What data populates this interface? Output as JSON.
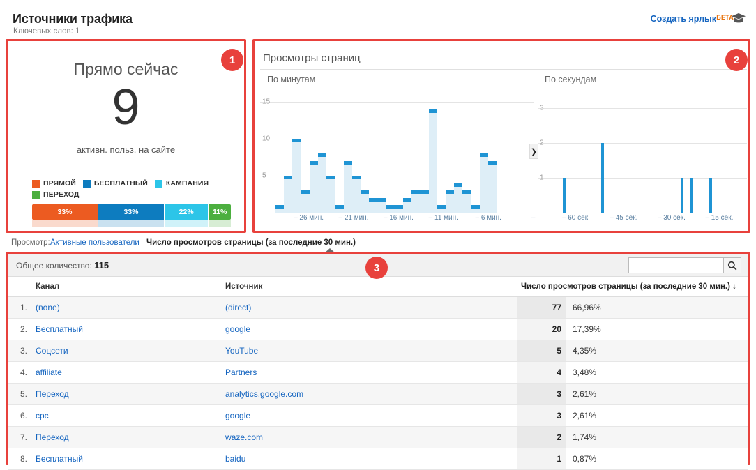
{
  "header": {
    "title": "Источники трафика",
    "subtitle": "Ключевых слов: 1",
    "create_shortcut": "Создать ярлык",
    "beta": "БЕТА",
    "cap_icon": "graduation-cap-icon"
  },
  "badges": {
    "one": "1",
    "two": "2",
    "three": "3"
  },
  "right_now": {
    "title": "Прямо сейчас",
    "count": "9",
    "caption": "активн. польз. на сайте",
    "legend": [
      {
        "label": "ПРЯМОЙ",
        "color": "#ec5b21"
      },
      {
        "label": "БЕСПЛАТНЫЙ",
        "color": "#0d7cbf"
      },
      {
        "label": "КАМПАНИЯ",
        "color": "#2cc5e8"
      },
      {
        "label": "ПЕРЕХОД",
        "color": "#4caf3f"
      }
    ],
    "segments": [
      {
        "label": "33%",
        "value": 33,
        "color": "#ec5b21"
      },
      {
        "label": "33%",
        "value": 33,
        "color": "#0d7cbf"
      },
      {
        "label": "22%",
        "value": 22,
        "color": "#2cc5e8"
      },
      {
        "label": "11%",
        "value": 11,
        "color": "#4caf3f"
      }
    ]
  },
  "pageviews": {
    "title": "Просмотры страниц",
    "handle_icon": "chevron-right-icon"
  },
  "chart_data": [
    {
      "type": "bar",
      "title": "По минутам",
      "xlabel": "",
      "ylabel": "",
      "ylim": [
        0,
        17
      ],
      "yticks": [
        5,
        10,
        15
      ],
      "grid": true,
      "legend": "none",
      "x": [
        -30,
        -29,
        -28,
        -27,
        -26,
        -25,
        -24,
        -23,
        -22,
        -21,
        -20,
        -19,
        -18,
        -17,
        -16,
        -15,
        -14,
        -13,
        -12,
        -11,
        -10,
        -9,
        -8,
        -7,
        -6,
        -5,
        -4,
        -3,
        -2,
        -1
      ],
      "tick_labels": [
        "– 26 мин.",
        "– 21 мин.",
        "– 16 мин.",
        "– 11 мин.",
        "– 6 мин.",
        "–"
      ],
      "values": [
        1,
        5,
        10,
        3,
        7,
        8,
        5,
        1,
        7,
        5,
        3,
        2,
        2,
        1,
        1,
        2,
        3,
        3,
        14,
        1,
        3,
        4,
        3,
        1,
        8,
        7,
        0,
        0,
        0,
        0
      ]
    },
    {
      "type": "bar",
      "title": "По секундам",
      "xlabel": "",
      "ylabel": "",
      "ylim": [
        0,
        3.6
      ],
      "yticks": [
        1,
        2,
        3
      ],
      "grid": true,
      "legend": "none",
      "tick_labels": [
        "– 60 сек.",
        "– 45 сек.",
        "– 30 сек.",
        "– 15 сек."
      ],
      "x": [
        -60,
        -59,
        -58,
        -57,
        -56,
        -55,
        -54,
        -53,
        -52,
        -51,
        -50,
        -49,
        -48,
        -47,
        -46,
        -45,
        -44,
        -43,
        -42,
        -41,
        -40,
        -39,
        -38,
        -37,
        -36,
        -35,
        -34,
        -33,
        -32,
        -31,
        -30,
        -29,
        -28,
        -27,
        -26,
        -25,
        -24,
        -23,
        -22,
        -21,
        -20,
        -19,
        -18,
        -17,
        -16,
        -15,
        -14,
        -13,
        -12,
        -11,
        -10,
        -9,
        -8,
        -7,
        -6,
        -5,
        -4,
        -3,
        -2,
        -1
      ],
      "values": [
        0,
        0,
        0,
        1,
        0,
        0,
        0,
        0,
        0,
        0,
        0,
        0,
        0,
        0,
        0,
        2,
        0,
        0,
        0,
        0,
        0,
        0,
        0,
        0,
        0,
        0,
        0,
        0,
        0,
        0,
        0,
        0,
        0,
        0,
        0,
        0,
        0,
        0,
        0,
        0,
        1,
        0,
        0,
        1,
        0,
        0,
        0,
        0,
        0,
        1,
        0,
        0,
        0,
        0,
        0,
        0,
        0,
        0,
        0,
        0
      ]
    }
  ],
  "viewbar": {
    "label": "Просмотр:",
    "options": [
      {
        "label": "Активные пользователи",
        "active": false
      },
      {
        "label": "Число просмотров страницы (за последние 30 мин.)",
        "active": true
      }
    ]
  },
  "table": {
    "total_label": "Общее количество:",
    "total_value": "115",
    "search_value": "",
    "search_placeholder": "",
    "search_icon": "search-icon",
    "columns": {
      "index": "",
      "channel": "Канал",
      "source": "Источник",
      "value": "Число просмотров страницы (за последние 30 мин.)",
      "sort_arrow": "↓",
      "percent": ""
    },
    "rows": [
      {
        "idx": "1.",
        "channel": "(none)",
        "source": "(direct)",
        "value": "77",
        "percent": "66,96%"
      },
      {
        "idx": "2.",
        "channel": "Бесплатный",
        "source": "google",
        "value": "20",
        "percent": "17,39%"
      },
      {
        "idx": "3.",
        "channel": "Соцсети",
        "source": "YouTube",
        "value": "5",
        "percent": "4,35%"
      },
      {
        "idx": "4.",
        "channel": "affiliate",
        "source": "Partners",
        "value": "4",
        "percent": "3,48%"
      },
      {
        "idx": "5.",
        "channel": "Переход",
        "source": "analytics.google.com",
        "value": "3",
        "percent": "2,61%"
      },
      {
        "idx": "6.",
        "channel": "cpc",
        "source": "google",
        "value": "3",
        "percent": "2,61%"
      },
      {
        "idx": "7.",
        "channel": "Переход",
        "source": "waze.com",
        "value": "2",
        "percent": "1,74%"
      },
      {
        "idx": "8.",
        "channel": "Бесплатный",
        "source": "baidu",
        "value": "1",
        "percent": "0,87%"
      }
    ]
  }
}
